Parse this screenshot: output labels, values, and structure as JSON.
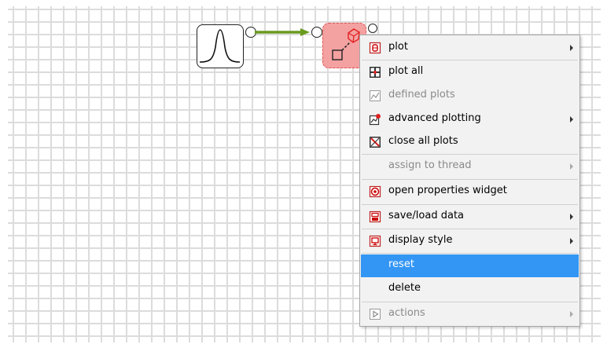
{
  "menu": {
    "items": [
      {
        "label": "plot",
        "icon": "plot-icon",
        "submenu": true,
        "enabled": true
      },
      {
        "label": "plot all",
        "icon": "plot-all-icon",
        "submenu": false,
        "enabled": true
      },
      {
        "label": "defined plots",
        "icon": "defined-plots-icon",
        "submenu": false,
        "enabled": false
      },
      {
        "label": "advanced plotting",
        "icon": "advanced-plotting-icon",
        "submenu": true,
        "enabled": true
      },
      {
        "label": "close all plots",
        "icon": "close-all-plots-icon",
        "submenu": false,
        "enabled": true
      },
      {
        "label": "assign to thread",
        "icon": "",
        "submenu": true,
        "enabled": false
      },
      {
        "label": "open properties widget",
        "icon": "properties-icon",
        "submenu": false,
        "enabled": true
      },
      {
        "label": "save/load data",
        "icon": "save-load-icon",
        "submenu": true,
        "enabled": true
      },
      {
        "label": "display style",
        "icon": "display-style-icon",
        "submenu": true,
        "enabled": true
      },
      {
        "label": "reset",
        "icon": "",
        "submenu": false,
        "enabled": true,
        "selected": true
      },
      {
        "label": "delete",
        "icon": "",
        "submenu": false,
        "enabled": true
      },
      {
        "label": "actions",
        "icon": "actions-icon",
        "submenu": true,
        "enabled": false
      }
    ]
  },
  "colors": {
    "selection": "#3396f4",
    "wire": "#6a9a1f",
    "selected_node_fill": "#f4a1a1",
    "selected_node_border": "#e05555",
    "grid": "#dcdcdc"
  }
}
